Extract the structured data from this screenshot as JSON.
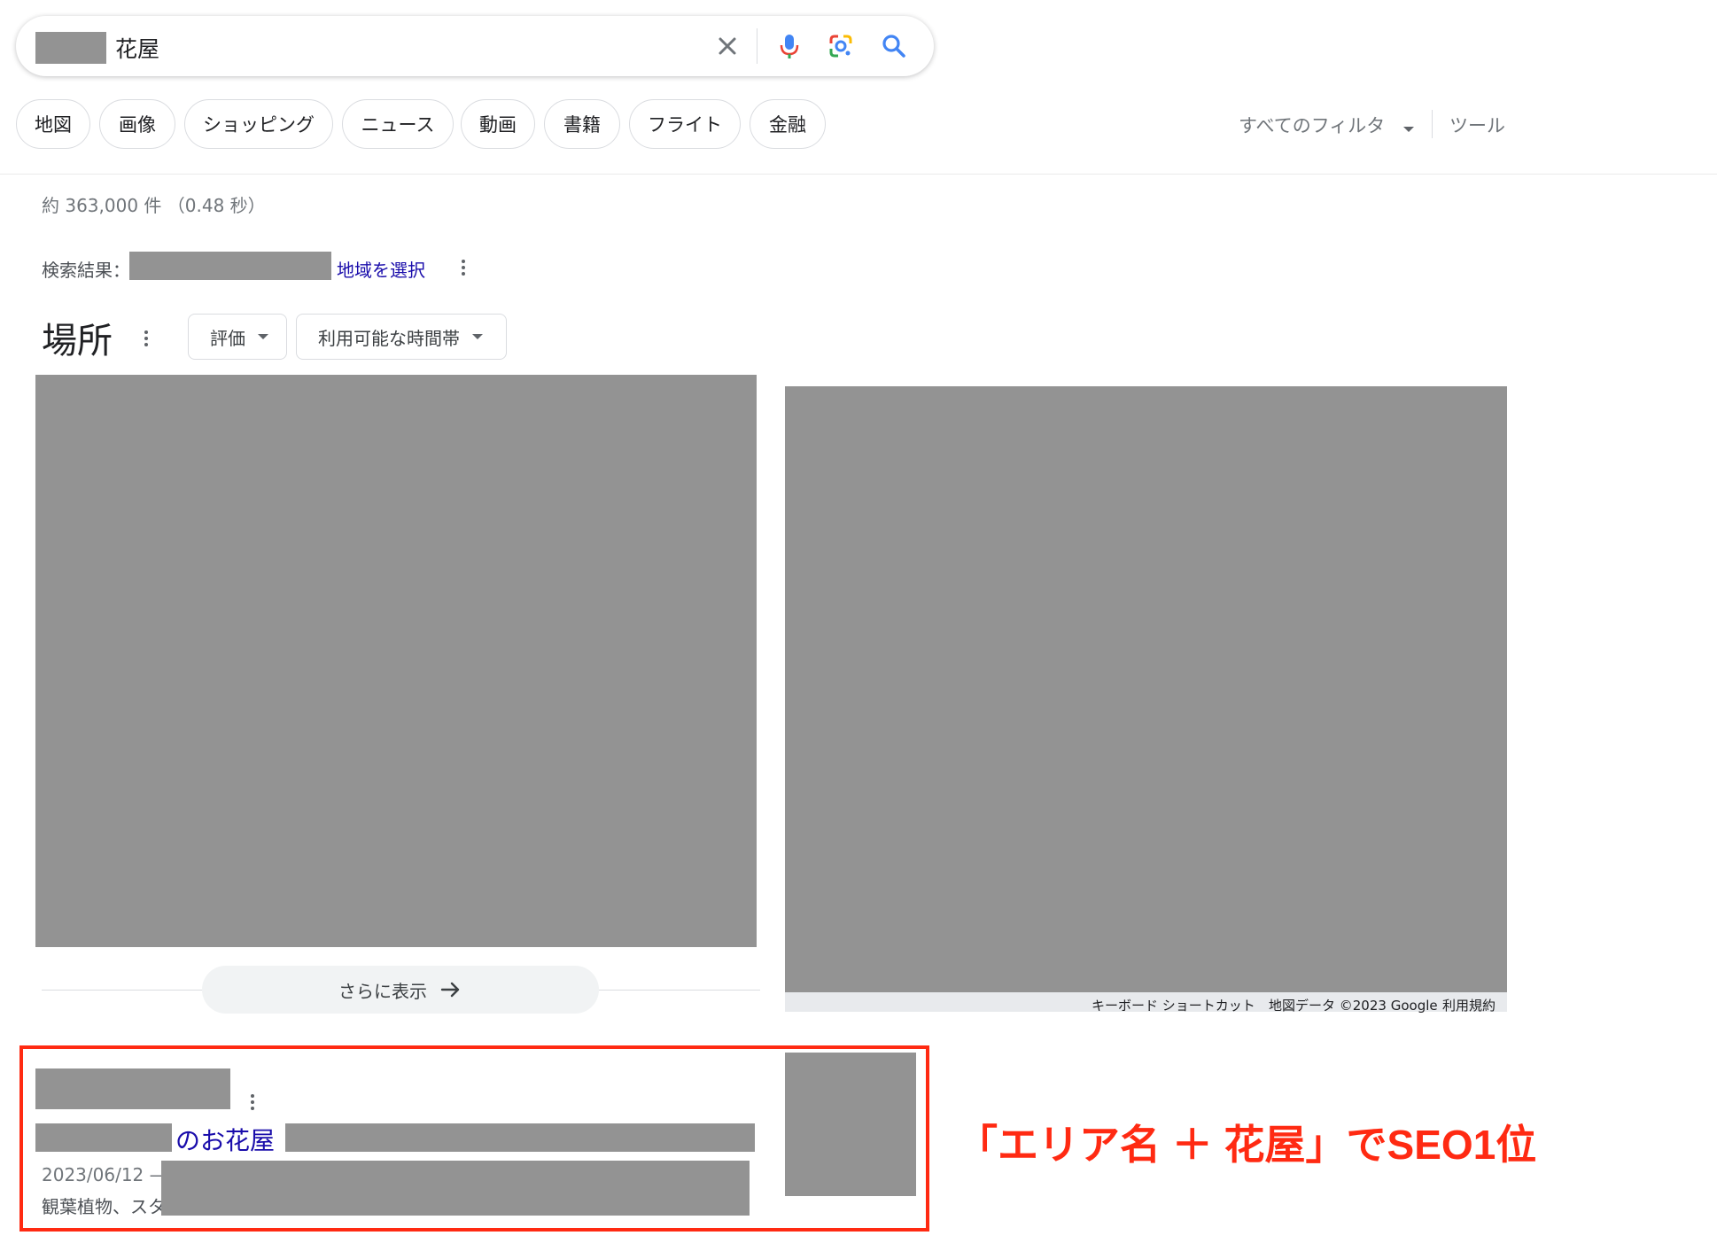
{
  "search": {
    "query": "花屋",
    "clear_icon": "close-icon",
    "mic_icon": "microphone-icon",
    "lens_icon": "lens-icon",
    "search_icon": "search-icon"
  },
  "chips": [
    "地図",
    "画像",
    "ショッピング",
    "ニュース",
    "動画",
    "書籍",
    "フライト",
    "金融"
  ],
  "tools": {
    "all_filters": "すべてのフィルタ",
    "tools": "ツール"
  },
  "stats": "約 363,000 件 （0.48 秒）",
  "region": {
    "label": "検索結果：",
    "link": "地域を選択"
  },
  "places": {
    "title": "場所",
    "filters": [
      "評価",
      "利用可能な時間帯"
    ],
    "more": "さらに表示",
    "map_attribution": {
      "shortcuts": "キーボード ショートカット",
      "data": "地図データ ©2023 Google",
      "terms": "利用規約"
    }
  },
  "result": {
    "title_visible": "のお花屋",
    "date": "2023/06/12 —",
    "snippet_start": "観葉植物、スタ"
  },
  "annotation": {
    "text": "「エリア名 ＋ 花屋」でSEO1位",
    "color": "#ff2a12"
  },
  "colors": {
    "link": "#1a0dab",
    "redaction": "#939393",
    "accent_red": "#ff2a12"
  }
}
